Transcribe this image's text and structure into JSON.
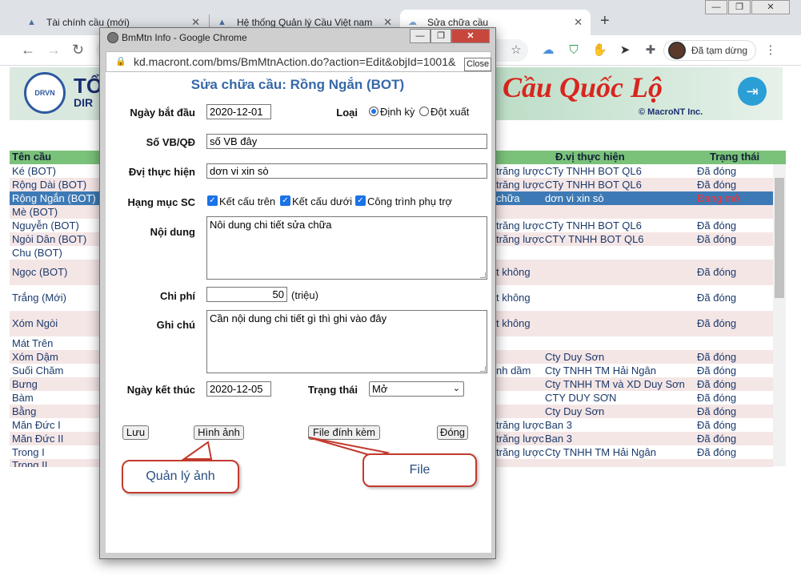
{
  "browser": {
    "tabs": [
      {
        "label": "Tài chính cầu (mới)"
      },
      {
        "label": "Hệ thống Quản lý Cầu Việt nam"
      },
      {
        "label": "Sửa chữa cầu"
      }
    ],
    "profile_label": "Đã tạm dừng"
  },
  "page": {
    "banner_left": "TỔ",
    "banner_left2": "DIR",
    "banner_title": "Cầu Quốc Lộ",
    "banner_copyright": "© MacroNT Inc.",
    "logo_text": "DRVN",
    "columns": {
      "name": "Tên cầu",
      "unit": "Đ.vị thực hiện",
      "status": "Trạng thái"
    },
    "rows": [
      {
        "name": "Ké (BOT)",
        "mid": "trăng lược",
        "unit": "CTy TNHH BOT QL6",
        "status": "Đã đóng"
      },
      {
        "name": "Rộng Dài (BOT)",
        "mid": "trăng lược",
        "unit": "CTy TNHH BOT QL6",
        "status": "Đã đóng"
      },
      {
        "name": "Rộng Ngắn (BOT)",
        "mid": "chữa",
        "unit": "dơn vi xin sò",
        "status": "Đang mở"
      },
      {
        "name": "Mè (BOT)",
        "mid": "",
        "unit": "",
        "status": ""
      },
      {
        "name": "Nguyễn (BOT)",
        "mid": "trăng lược",
        "unit": "CTy TNHH BOT QL6",
        "status": "Đã đóng"
      },
      {
        "name": "Ngòi Dân (BOT)",
        "mid": "trăng lược",
        "unit": "CTY TNHH BOT QL6",
        "status": "Đã đóng"
      },
      {
        "name": "Chu (BOT)",
        "mid": "",
        "unit": "",
        "status": ""
      },
      {
        "name": "Ngọc (BOT)",
        "mid": "t không",
        "unit": "",
        "status": "Đã đóng"
      },
      {
        "name": "Trắng (Mới)",
        "mid": "t không",
        "unit": "",
        "status": "Đã đóng"
      },
      {
        "name": "Xóm Ngòi",
        "mid": "t không",
        "unit": "",
        "status": "Đã đóng"
      },
      {
        "name": "Mát Trên",
        "mid": "",
        "unit": "",
        "status": ""
      },
      {
        "name": "Xóm Dậm",
        "mid": "",
        "unit": "Cty Duy Sơn",
        "status": "Đã đóng"
      },
      {
        "name": "Suối Chăm",
        "mid": "nh dầm",
        "unit": "Cty TNHH TM Hải Ngân",
        "status": "Đã đóng"
      },
      {
        "name": "Bưng",
        "mid": "",
        "unit": "Cty TNHH TM và XD Duy Sơn",
        "status": "Đã đóng"
      },
      {
        "name": "Bàm",
        "mid": "",
        "unit": "CTY DUY SƠN",
        "status": "Đã đóng"
      },
      {
        "name": "Bằng",
        "mid": "",
        "unit": "Cty Duy Sơn",
        "status": "Đã đóng"
      },
      {
        "name": "Măn Đức I",
        "mid": "trăng lược",
        "unit": "Ban 3",
        "status": "Đã đóng"
      },
      {
        "name": "Măn Đức II",
        "mid": "trăng lược",
        "unit": "Ban 3",
        "status": "Đã đóng"
      },
      {
        "name": "Trong I",
        "mid": "trăng lược",
        "unit": "Cty TNHH TM Hải Ngân",
        "status": "Đã đóng"
      },
      {
        "name": "Trong II",
        "mid": "",
        "unit": "",
        "status": ""
      }
    ]
  },
  "popup": {
    "window_title": "BmMtn Info - Google Chrome",
    "close_tooltip": "Close",
    "url": "kd.macront.com/bms/BmMtnAction.do?action=Edit&objId=1001&",
    "form_title": "Sửa chữa cầu: Rồng Ngắn (BOT)",
    "labels": {
      "start_date": "Ngày bắt đầu",
      "type": "Loại",
      "doc_no": "Số VB/QĐ",
      "unit": "Đvị thực hiện",
      "items": "Hạng mục SC",
      "content": "Nội dung",
      "cost": "Chi phí",
      "note": "Ghi chú",
      "end_date": "Ngày kết thúc",
      "status": "Trạng thái"
    },
    "values": {
      "start_date": "2020-12-01",
      "doc_no": "số VB đây",
      "unit": "dơn vi xin sò",
      "content": "Nôi dung chi tiết sửa chữa",
      "cost": "50",
      "cost_unit": "(triệu)",
      "note": "Cần nội dung chi tiết gì thì ghi vào đây",
      "end_date": "2020-12-05",
      "status": "Mở"
    },
    "type_options": {
      "periodic": "Định kỳ",
      "adhoc": "Đột xuất"
    },
    "item_options": {
      "upper": "Kết cấu trên",
      "lower": "Kết cấu dưới",
      "aux": "Công trình phụ trợ"
    },
    "buttons": {
      "save": "Lưu",
      "images": "Hình ảnh",
      "attach": "File đính kèm",
      "close": "Đóng"
    }
  },
  "callouts": {
    "images": "Quản lý ảnh",
    "file": "File"
  }
}
